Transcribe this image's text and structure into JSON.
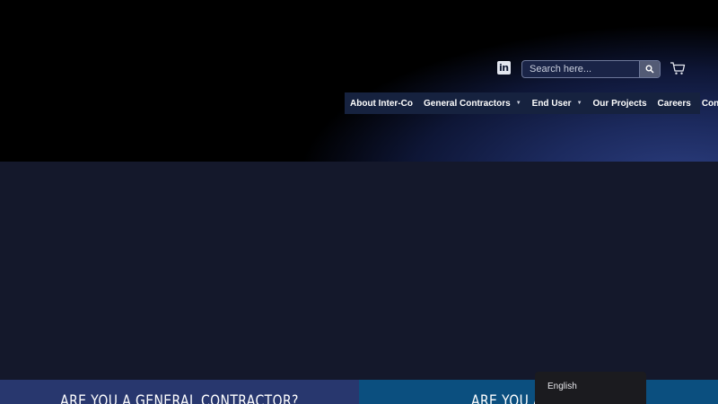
{
  "header": {
    "social": {
      "icon": "linkedin-icon",
      "label": "in"
    },
    "search": {
      "placeholder": "Search here...",
      "icon": "search-icon"
    },
    "cart_icon": "cart-icon"
  },
  "nav": {
    "items": [
      {
        "label": "About Inter-Co",
        "has_dropdown": false
      },
      {
        "label": "General Contractors",
        "has_dropdown": true
      },
      {
        "label": "End User",
        "has_dropdown": true
      },
      {
        "label": "Our Projects",
        "has_dropdown": false
      },
      {
        "label": "Careers",
        "has_dropdown": false
      },
      {
        "label": "Contact Us",
        "has_dropdown": false
      }
    ],
    "caret": "▼"
  },
  "panels": {
    "left_title": "ARE YOU A GENERAL CONTRACTOR?",
    "right_title": "ARE YOU AN END USER?"
  },
  "language": {
    "current": "English"
  },
  "colors": {
    "nav_bg": "#16223f",
    "hero_bg": "#14182b",
    "panel_left": "#28376e",
    "panel_right": "#0b4f7f",
    "lang_bg": "#1b1b1f"
  }
}
